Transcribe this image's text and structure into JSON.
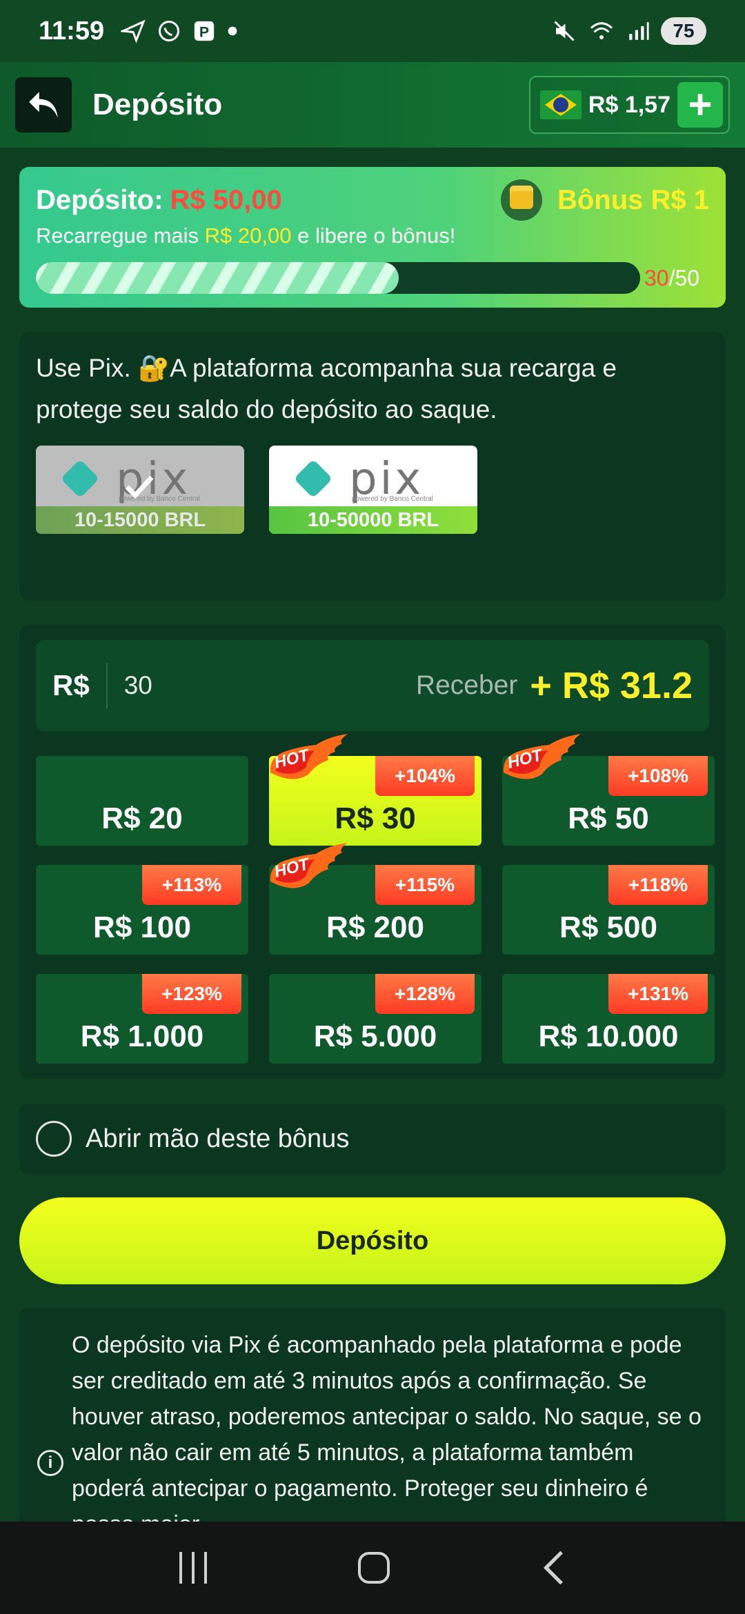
{
  "status_bar": {
    "time": "11:59",
    "battery": "75"
  },
  "header": {
    "title": "Depósito",
    "balance": "R$ 1,57",
    "add_label": "+"
  },
  "bonus": {
    "deposit_label": "Depósito:",
    "deposit_amount": "R$ 50,00",
    "bonus_label": "Bônus R$ 1",
    "recharge_prefix": "Recarregue mais ",
    "recharge_amount": "R$ 20,00",
    "recharge_suffix": " e libere o bônus!",
    "progress_current": "30",
    "progress_total": "/50",
    "progress_fraction": 0.6
  },
  "pix": {
    "description": "Use Pix. 🔐A plataforma acompanha sua recarga e protege seu saldo do depósito ao saque.",
    "logo_word": "pix",
    "logo_sub": "powered by Banco Central",
    "options": [
      {
        "range": "10-15000 BRL",
        "selected": true
      },
      {
        "range": "10-50000 BRL",
        "selected": false
      }
    ]
  },
  "amount": {
    "currency": "R$",
    "value": "30",
    "receive_label": "Receber",
    "receive_amount": "+ R$ 31.2",
    "hot_label": "HOT",
    "options": [
      {
        "label": "R$ 20",
        "badge": "",
        "hot": false,
        "selected": false
      },
      {
        "label": "R$ 30",
        "badge": "+104%",
        "hot": true,
        "selected": true
      },
      {
        "label": "R$ 50",
        "badge": "+108%",
        "hot": true,
        "selected": false
      },
      {
        "label": "R$ 100",
        "badge": "+113%",
        "hot": false,
        "selected": false
      },
      {
        "label": "R$ 200",
        "badge": "+115%",
        "hot": true,
        "selected": false
      },
      {
        "label": "R$ 500",
        "badge": "+118%",
        "hot": false,
        "selected": false
      },
      {
        "label": "R$ 1.000",
        "badge": "+123%",
        "hot": false,
        "selected": false
      },
      {
        "label": "R$ 5.000",
        "badge": "+128%",
        "hot": false,
        "selected": false
      },
      {
        "label": "R$ 10.000",
        "badge": "+131%",
        "hot": false,
        "selected": false
      }
    ]
  },
  "waive": {
    "label": "Abrir mão deste bônus"
  },
  "deposit_button": {
    "label": "Depósito"
  },
  "info": {
    "text": "O depósito via Pix é acompanhado pela plataforma e pode ser creditado em até 3 minutos após a confirmação. Se houver atraso, poderemos antecipar o saldo. No saque, se o valor não cair em até 5 minutos, a plataforma também poderá antecipar o pagamento. Proteger seu dinheiro é nossa maior"
  },
  "colors": {
    "accent_yellow": "#ffee2a",
    "accent_red": "#ff4a3d",
    "bg_dark_green": "#0b3620",
    "button_lime": "#d8fa1b"
  }
}
